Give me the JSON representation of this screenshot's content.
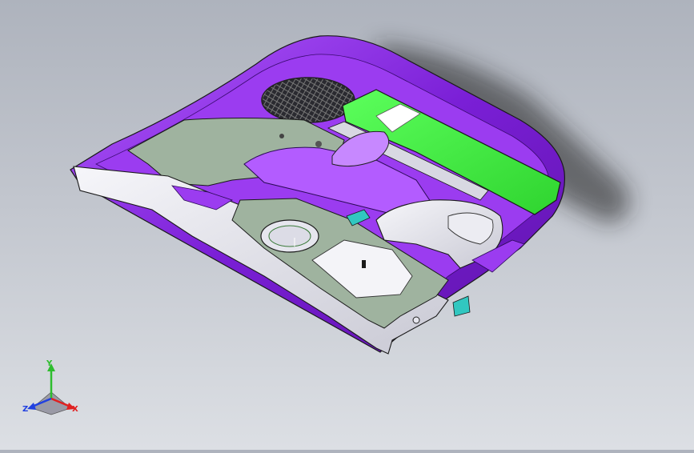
{
  "viewport": {
    "background_top": "#aeb3bd",
    "background_bottom": "#dcdfe4"
  },
  "model": {
    "colors": {
      "shell_purple": "#7a1fd6",
      "shell_purple_light": "#a64df0",
      "panel_green_gray": "#9fb39f",
      "part_gray": "#e6e6ee",
      "part_white": "#f4f4f8",
      "bright_green": "#3df23d",
      "cyan_tab": "#31c7c0",
      "edge_black": "#1a1a1a"
    }
  },
  "triad": {
    "y_label": "Y",
    "x_label": "X",
    "z_label": "Z",
    "y_color": "#2ebd2e",
    "x_color": "#e02020",
    "z_color": "#2040e0"
  }
}
